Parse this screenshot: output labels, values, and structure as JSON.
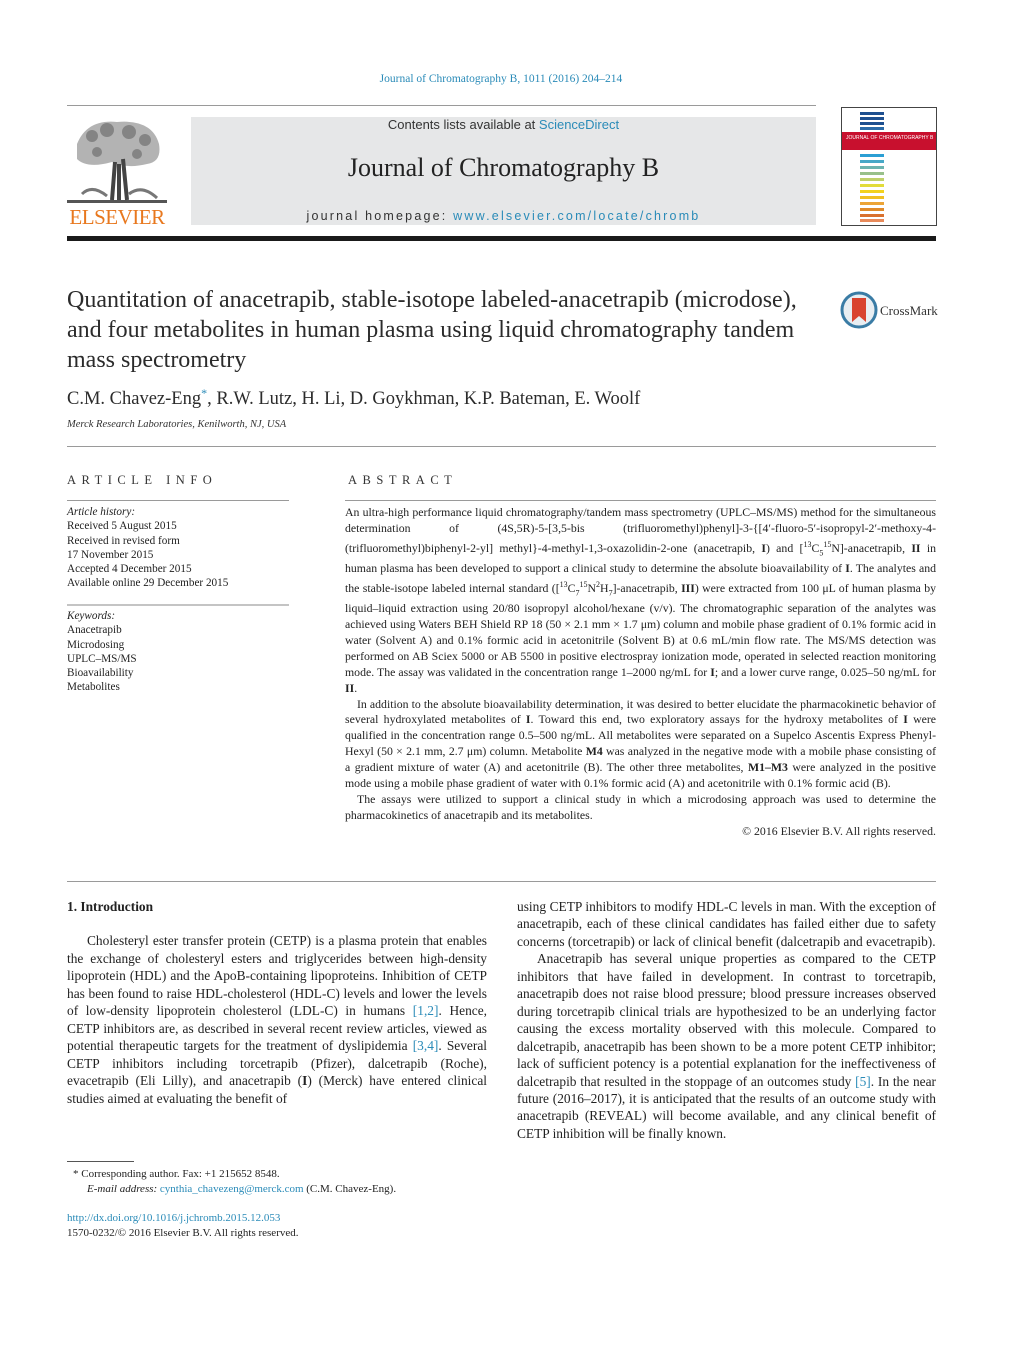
{
  "header": {
    "citation": "Journal of Chromatography B, 1011 (2016) 204–214",
    "contents_prefix": "Contents lists available at ",
    "contents_link": "ScienceDirect",
    "journal_name": "Journal of Chromatography B",
    "homepage_prefix": "journal homepage: ",
    "homepage_url": "www.elsevier.com/locate/chromb",
    "publisher_logo": "ELSEVIER",
    "cover_title": "JOURNAL OF CHROMATOGRAPHY B",
    "crossmark_label": "CrossMark"
  },
  "colors": {
    "link": "#2a8bb8",
    "elsevier_orange": "#e8781e",
    "masthead_gray": "#e6e7e8",
    "cover_red": "#c8102e"
  },
  "article": {
    "title": "Quantitation of anacetrapib, stable-isotope labeled-anacetrapib (microdose), and four metabolites in human plasma using liquid chromatography tandem mass spectrometry",
    "first_author": "C.M. Chavez-Eng",
    "corresponding_mark": "*",
    "other_authors": ", R.W. Lutz, H. Li, D. Goykhman, K.P. Bateman, E. Woolf",
    "affiliation": "Merck Research Laboratories, Kenilworth, NJ, USA"
  },
  "article_info": {
    "heading": "ARTICLE INFO",
    "history_label": "Article history:",
    "history": [
      "Received 5 August 2015",
      "Received in revised form",
      "17 November 2015",
      "Accepted 4 December 2015",
      "Available online 29 December 2015"
    ],
    "keywords_label": "Keywords:",
    "keywords": [
      "Anacetrapib",
      "Microdosing",
      "UPLC–MS/MS",
      "Bioavailability",
      "Metabolites"
    ]
  },
  "abstract": {
    "heading": "ABSTRACT",
    "p1_a": "An ultra-high performance liquid chromatography/tandem mass spectrometry (UPLC–MS/MS) method for the simultaneous determination of (4S,5R)-5-[3,5-bis (trifluoromethyl)phenyl]-3-{[4′-fluoro-5′-isopropyl-2′-methoxy-4-(trifluoromethyl)biphenyl-2-yl] methyl}-4-methyl-1,3-oxazolidin-2-one (anacetrapib, ",
    "p1_b": ") and [",
    "p1_c": "]-anacetrapib, ",
    "p1_d": " in human plasma has been developed to support a clinical study to determine the absolute bioavailability of ",
    "p1_e": ". The analytes and the stable-isotope labeled internal standard ([",
    "p1_f": "]-anacetrapib, ",
    "p1_g": ") were extracted from 100 μL of human plasma by liquid–liquid extraction using 20/80 isopropyl alcohol/hexane (v/v). The chromatographic separation of the analytes was achieved using Waters BEH Shield RP 18 (50 × 2.1 mm × 1.7 μm) column and mobile phase gradient of 0.1% formic acid in water (Solvent A) and 0.1% formic acid in acetonitrile (Solvent B) at 0.6 mL/min flow rate. The MS/MS detection was performed on AB Sciex 5000 or AB 5500 in positive electrospray ionization mode, operated in selected reaction monitoring mode. The assay was validated in the concentration range 1–2000 ng/mL for ",
    "p1_h": "; and a lower curve range, 0.025–50 ng/mL for ",
    "p1_i": ".",
    "cpd_I": "I",
    "cpd_II": "II",
    "cpd_III": "III",
    "iso1": "13C5 15N",
    "iso2": "13C7 15N2H7",
    "p2_a": "In addition to the absolute bioavailability determination, it was desired to better elucidate the pharmacokinetic behavior of several hydroxylated metabolites of ",
    "p2_b": ". Toward this end, two exploratory assays for the hydroxy metabolites of ",
    "p2_c": " were qualified in the concentration range 0.5–500 ng/mL. All metabolites were separated on a Supelco Ascentis Express Phenyl-Hexyl (50 × 2.1 mm, 2.7 μm) column. Metabolite ",
    "m4": "M4",
    "p2_d": " was analyzed in the negative mode with a mobile phase consisting of a gradient mixture of water (A) and acetonitrile (B). The other three metabolites, ",
    "m1m3": "M1–M3",
    "p2_e": " were analyzed in the positive mode using a mobile phase gradient of water with 0.1% formic acid (A) and acetonitrile with 0.1% formic acid (B).",
    "p3": "The assays were utilized to support a clinical study in which a microdosing approach was used to determine the pharmacokinetics of anacetrapib and its metabolites.",
    "copyright": "© 2016 Elsevier B.V. All rights reserved."
  },
  "introduction": {
    "heading": "1.  Introduction",
    "left_p1_a": "Cholesteryl ester transfer protein (CETP) is a plasma protein that enables the exchange of cholesteryl esters and triglycerides between high-density lipoprotein (HDL) and the ApoB-containing lipoproteins. Inhibition of CETP has been found to raise HDL-cholesterol (HDL-C) levels and lower the levels of low-density lipoprotein cholesterol (LDL-C) in humans ",
    "ref_1_2": "[1,2]",
    "left_p1_b": ". Hence, CETP inhibitors are, as described in several recent review articles, viewed as potential therapeutic targets for the treatment of dyslipidemia ",
    "ref_3_4": "[3,4]",
    "left_p1_c": ". Several CETP inhibitors including torcetrapib (Pfizer), dalcetrapib (Roche), evacetrapib (Eli Lilly), and anacetrapib (",
    "left_p1_bold": "I",
    "left_p1_d": ") (Merck) have entered clinical studies aimed at evaluating the benefit of",
    "right_p1": "using CETP inhibitors to modify HDL-C levels in man. With the exception of anacetrapib, each of these clinical candidates has failed either due to safety concerns (torcetrapib) or lack of clinical benefit (dalcetrapib and evacetrapib).",
    "right_p2_a": "Anacetrapib has several unique properties as compared to the CETP inhibitors that have failed in development. In contrast to torcetrapib, anacetrapib does not raise blood pressure; blood pressure increases observed during torcetrapib clinical trials are hypothesized to be an underlying factor causing the excess mortality observed with this molecule. Compared to dalcetrapib, anacetrapib has been shown to be a more potent CETP inhibitor; lack of sufficient potency is a potential explanation for the ineffectiveness of dalcetrapib that resulted in the stoppage of an outcomes study ",
    "ref_5": "[5]",
    "right_p2_b": ". In the near future (2016–2017), it is anticipated that the results of an outcome study with anacetrapib (REVEAL) will become available, and any clinical benefit of CETP inhibition will be finally known."
  },
  "footnote": {
    "mark": "*",
    "corresponding": " Corresponding author. Fax: +1 215652 8548.",
    "email_label": "E-mail address: ",
    "email": "cynthia_chavezeng@merck.com",
    "email_suffix": " (C.M. Chavez-Eng).",
    "doi": "http://dx.doi.org/10.1016/j.jchromb.2015.12.053",
    "issn_line": "1570-0232/© 2016 Elsevier B.V. All rights reserved."
  }
}
